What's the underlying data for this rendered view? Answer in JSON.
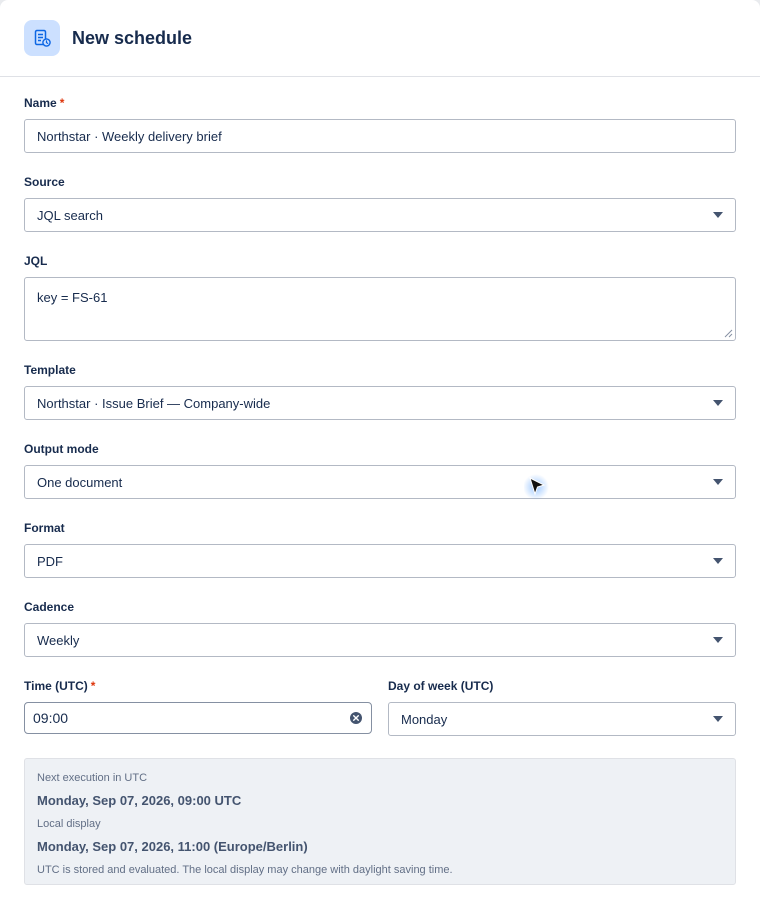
{
  "header": {
    "title": "New schedule",
    "icon": "document-schedule-icon",
    "icon_color": "#cce0ff"
  },
  "fields": {
    "name": {
      "label": "Name",
      "required_mark": "*",
      "value": "Northstar · Weekly delivery brief"
    },
    "source": {
      "label": "Source",
      "value": "JQL search"
    },
    "jql": {
      "label": "JQL",
      "value": "key = FS-61"
    },
    "template": {
      "label": "Template",
      "value": "Northstar · Issue Brief — Company-wide"
    },
    "output_mode": {
      "label": "Output mode",
      "value": "One document"
    },
    "format": {
      "label": "Format",
      "value": "PDF"
    },
    "cadence": {
      "label": "Cadence",
      "value": "Weekly"
    },
    "time": {
      "label": "Time (UTC)",
      "required_mark": "*",
      "value": "09:00"
    },
    "day_of_week": {
      "label": "Day of week (UTC)",
      "value": "Monday"
    }
  },
  "info": {
    "next_label": "Next execution in UTC",
    "next_value": "Monday, Sep 07, 2026, 09:00 UTC",
    "local_label": "Local display",
    "local_value": "Monday, Sep 07, 2026, 11:00 (Europe/Berlin)",
    "note": "UTC is stored and evaluated. The local display may change with daylight saving time."
  },
  "colors": {
    "required": "#de350b",
    "text": "#172b4d",
    "info_bg": "#eef1f5"
  }
}
